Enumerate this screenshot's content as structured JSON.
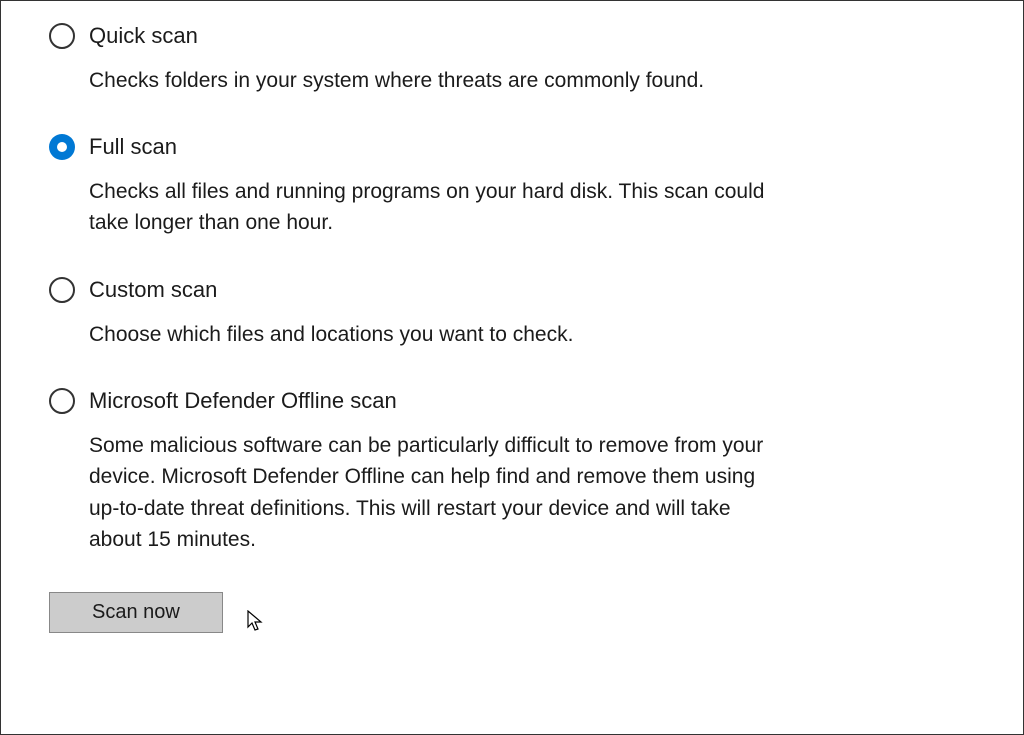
{
  "options": [
    {
      "title": "Quick scan",
      "desc": "Checks folders in your system where threats are commonly found.",
      "selected": false
    },
    {
      "title": "Full scan",
      "desc": "Checks all files and running programs on your hard disk. This scan could take longer than one hour.",
      "selected": true
    },
    {
      "title": "Custom scan",
      "desc": "Choose which files and locations you want to check.",
      "selected": false
    },
    {
      "title": "Microsoft Defender Offline scan",
      "desc": "Some malicious software can be particularly difficult to remove from your device. Microsoft Defender Offline can help find and remove them using up-to-date threat definitions. This will restart your device and will take about 15 minutes.",
      "selected": false
    }
  ],
  "button": {
    "scan_now": "Scan now"
  },
  "colors": {
    "accent": "#0078d4"
  }
}
